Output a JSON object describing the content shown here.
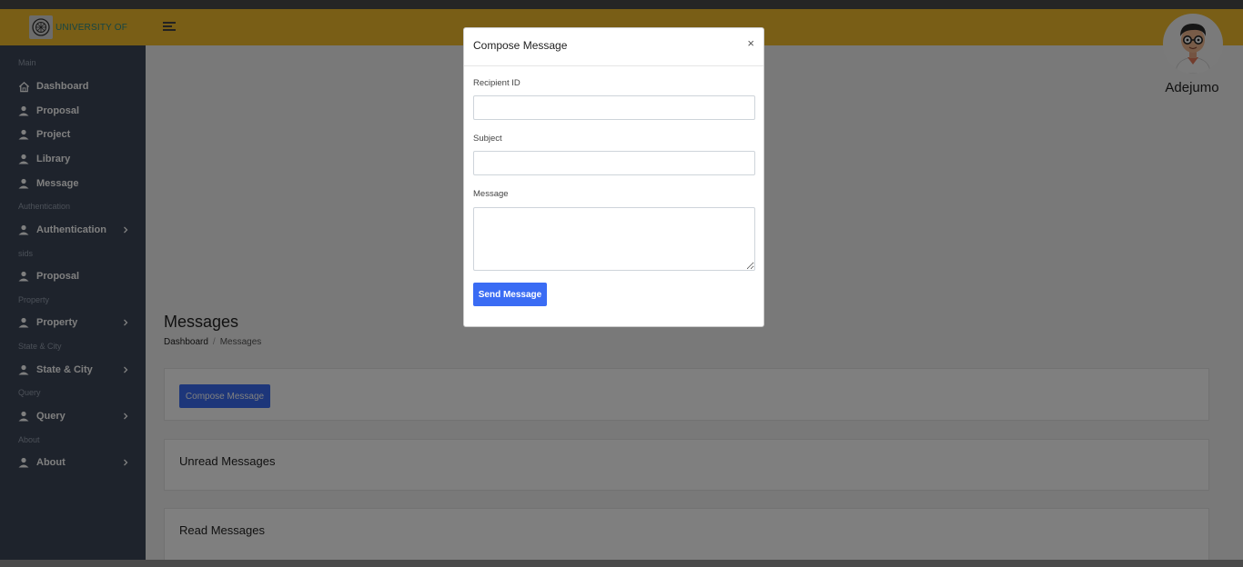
{
  "header": {
    "logo_text": "UNIVERSITY OF",
    "username": "Adejumo"
  },
  "sidebar": {
    "sections": [
      {
        "label": "Main"
      },
      {
        "label": "Authentication"
      },
      {
        "label": "sids"
      },
      {
        "label": "Property"
      },
      {
        "label": "State & City"
      },
      {
        "label": "Query"
      },
      {
        "label": "About"
      }
    ],
    "items": [
      {
        "label": "Dashboard",
        "icon": "home-icon"
      },
      {
        "label": "Proposal",
        "icon": "user-icon"
      },
      {
        "label": "Project",
        "icon": "user-icon"
      },
      {
        "label": "Library",
        "icon": "user-icon"
      },
      {
        "label": "Message",
        "icon": "user-icon"
      },
      {
        "label": "Authentication",
        "icon": "user-icon",
        "expandable": true
      },
      {
        "label": "Proposal",
        "icon": "user-icon"
      },
      {
        "label": "Property",
        "icon": "user-icon",
        "expandable": true
      },
      {
        "label": "State & City",
        "icon": "user-icon",
        "expandable": true
      },
      {
        "label": "Query",
        "icon": "user-icon",
        "expandable": true
      },
      {
        "label": "About",
        "icon": "user-icon",
        "expandable": true
      }
    ]
  },
  "page": {
    "title": "Messages",
    "breadcrumb": {
      "home": "Dashboard",
      "separator": "/",
      "current": "Messages"
    },
    "compose_button": "Compose Message",
    "unread_title": "Unread Messages",
    "read_title": "Read Messages"
  },
  "modal": {
    "title": "Compose Message",
    "close": "×",
    "recipient_label": "Recipient ID",
    "recipient_value": "",
    "subject_label": "Subject",
    "subject_value": "",
    "message_label": "Message",
    "message_value": "",
    "send_button": "Send Message"
  },
  "colors": {
    "header": "#f2bc2c",
    "sidebar": "#3d4759",
    "primary_button": "#3a6cf4"
  }
}
